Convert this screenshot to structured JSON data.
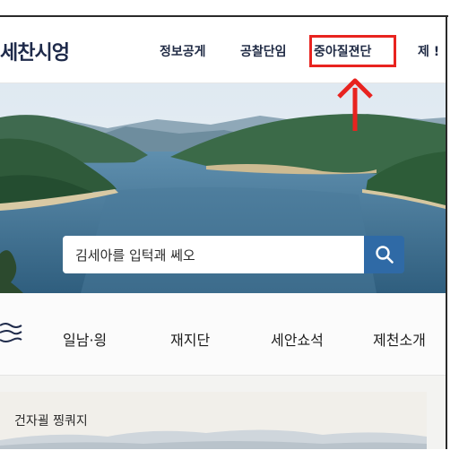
{
  "header": {
    "logo_text": "세찬시엉",
    "nav": [
      {
        "label": "정보공게"
      },
      {
        "label": "공찰단임"
      },
      {
        "label": "중아질젼단"
      },
      {
        "label": "제 !"
      }
    ]
  },
  "hero": {
    "search": {
      "placeholder": "김세아를 입턱괘 쎄오"
    },
    "search_icon": "search-icon"
  },
  "quick_menu": {
    "icon": "menu-waves-icon",
    "items": [
      {
        "label": "일남·읭"
      },
      {
        "label": "재지단"
      },
      {
        "label": "세안쇼석"
      },
      {
        "label": "제천소개"
      }
    ]
  },
  "news": {
    "title": "건자괼 찡쿼지"
  },
  "colors": {
    "annotation": "#e8231f",
    "brand_navy": "#1e2a4a",
    "search_button": "#2f6aa6"
  }
}
